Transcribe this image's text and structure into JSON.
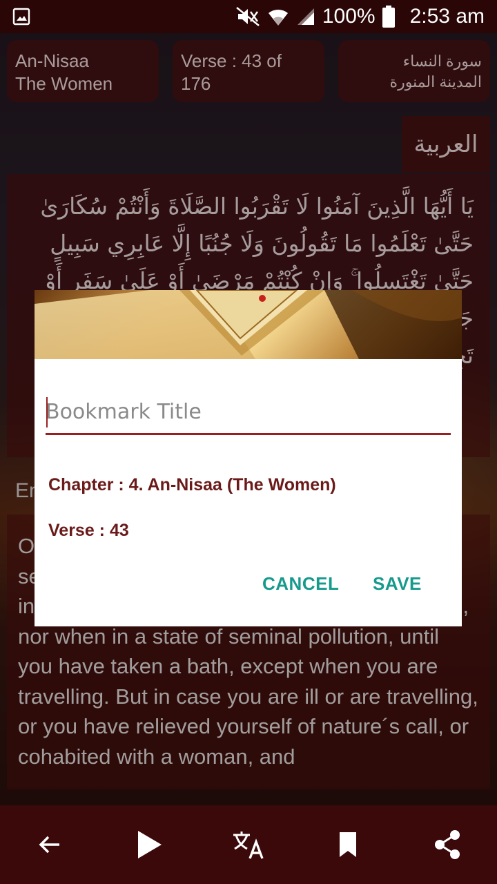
{
  "status_bar": {
    "battery": "100%",
    "time": "2:53 am",
    "icons": [
      "image-icon",
      "mute-icon",
      "wifi-icon",
      "signal-icon",
      "battery-icon"
    ]
  },
  "header": {
    "chapter_name_line1": "An-Nisaa",
    "chapter_name_line2": "The Women",
    "verse_line1": "Verse : 43 of",
    "verse_line2": "176",
    "arabic_title_line1": "سورة النساء",
    "arabic_title_line2": "المدينة المنورة"
  },
  "arabic_section": {
    "label": "العربية",
    "text": "يَا أَيُّهَا الَّذِينَ آمَنُوا لَا تَقْرَبُوا الصَّلَاةَ وَأَنْتُمْ سُكَارَىٰ حَتَّىٰ تَعْلَمُوا مَا تَقُولُونَ وَلَا جُنُبًا إِلَّا عَابِرِي سَبِيلٍ حَتَّىٰ تَغْتَسِلُوا ۚ وَإِنْ كُنْتُمْ مَرْضَىٰ أَوْ عَلَىٰ سَفَرٍ أَوْ جَاءَ أَحَدٌ مِنْكُمْ مِنَ الْغَائِطِ أَوْ لَامَسْتُمُ النِّسَاءَ فَلَمْ تَجِدُوا مَاءً فَتَيَمَّمُوا صَعِيدًا طَيِّبًا وَ"
  },
  "english_section": {
    "label": "English",
    "text": "O you who believe, do not approach your service of prayer when you are in a state of intoxication until you know what you are saying, nor when in a state of seminal pollution, until you have taken a bath, except when you are travelling. But in case you are ill or are travelling, or you have relieved yourself of nature´s call, or cohabited with a woman, and"
  },
  "dialog": {
    "title_placeholder": "Bookmark Title",
    "title_value": "",
    "chapter_info": "Chapter : 4. An-Nisaa (The Women)",
    "verse_info": "Verse : 43",
    "cancel_label": "CANCEL",
    "save_label": "SAVE"
  },
  "bottom_nav": {
    "items": [
      "back-arrow-icon",
      "play-icon",
      "translate-icon",
      "bookmark-icon",
      "share-icon"
    ]
  },
  "colors": {
    "accent_teal": "#159a8c",
    "dark_red": "#6b1a1a",
    "input_underline": "#9a2020",
    "nav_bg": "#3b0909"
  }
}
